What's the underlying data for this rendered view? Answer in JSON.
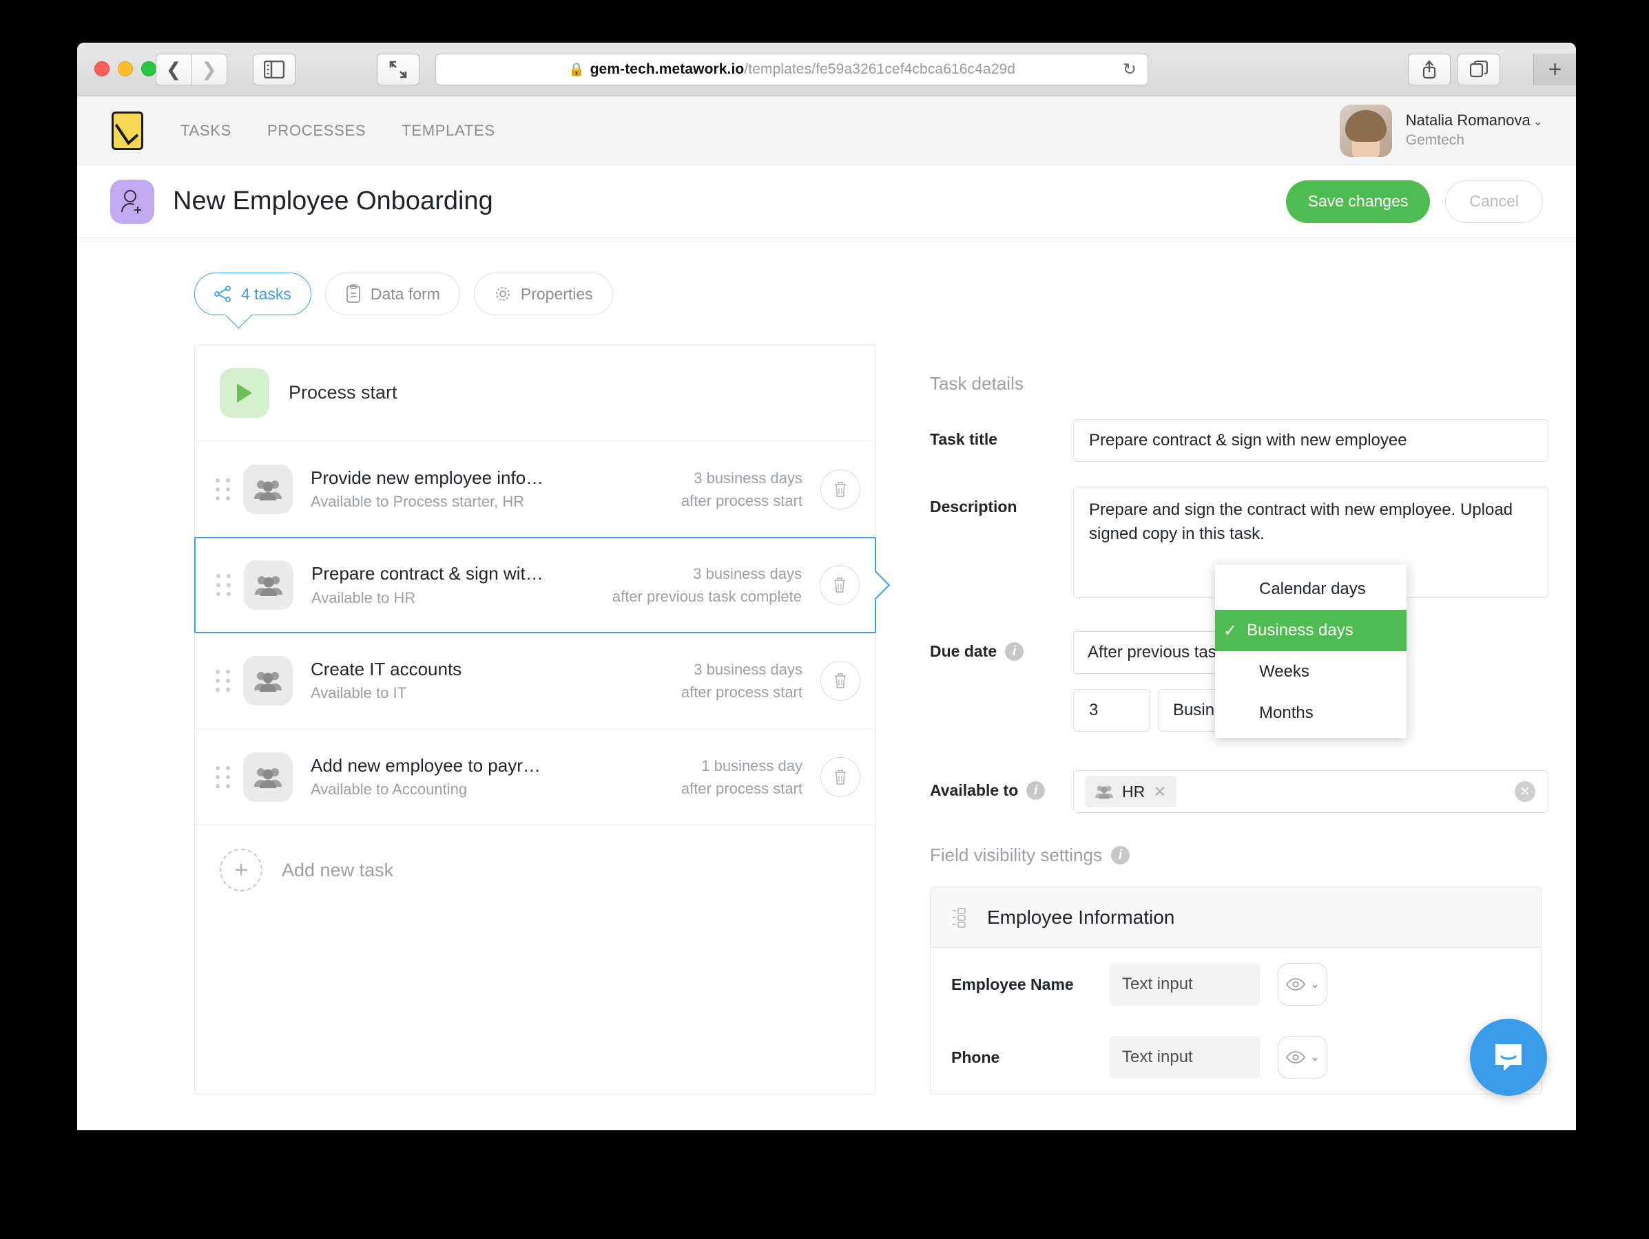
{
  "browser": {
    "url_secure_part": "gem-tech.metawork.io",
    "url_path": "/templates/fe59a3261cef4cbca616c4a29d",
    "back_icon": "back-chevron-icon",
    "forward_icon": "forward-chevron-icon",
    "sidebar_icon": "sidebar-toggle-icon",
    "fullscreen_icon": "fullscreen-icon",
    "reload_icon": "reload-icon",
    "share_icon": "share-icon",
    "tabs_icon": "show-tabs-icon",
    "newtab_label": "+"
  },
  "appnav": {
    "logo_name": "metawork-logo",
    "links": [
      "TASKS",
      "PROCESSES",
      "TEMPLATES"
    ],
    "user": {
      "name": "Natalia Romanova",
      "org": "Gemtech"
    }
  },
  "page_header": {
    "title": "New Employee Onboarding",
    "save_label": "Save changes",
    "cancel_label": "Cancel",
    "accent_green": "#4fbc51"
  },
  "tabs": [
    {
      "label": "4 tasks",
      "icon": "workflow-icon",
      "active": true
    },
    {
      "label": "Data form",
      "icon": "clipboard-icon",
      "active": false
    },
    {
      "label": "Properties",
      "icon": "gear-icon",
      "active": false
    }
  ],
  "task_list": {
    "process_start_label": "Process start",
    "add_new_task_label": "Add new task",
    "tasks": [
      {
        "title": "Provide new employee info…",
        "available": "Available to Process starter, HR",
        "due_amount": "3 business days",
        "due_when": "after process start",
        "selected": false
      },
      {
        "title": "Prepare contract & sign wit…",
        "available": "Available to HR",
        "due_amount": "3 business days",
        "due_when": "after previous task complete",
        "selected": true
      },
      {
        "title": "Create IT accounts",
        "available": "Available to IT",
        "due_amount": "3 business days",
        "due_when": "after process start",
        "selected": false
      },
      {
        "title": "Add new employee to payr…",
        "available": "Available to Accounting",
        "due_amount": "1 business day",
        "due_when": "after process start",
        "selected": false
      }
    ]
  },
  "details": {
    "section_title": "Task details",
    "task_title_label": "Task title",
    "task_title_value": "Prepare contract & sign with new employee",
    "description_label": "Description",
    "description_value": "Prepare and sign the contract with new employee. Upload signed copy in this task.",
    "due_date_label": "Due date",
    "due_date_trigger": "After previous task complete",
    "due_amount_value": "3",
    "due_unit_value": "Business days",
    "due_unit_options": [
      "Calendar days",
      "Business days",
      "Weeks",
      "Months"
    ],
    "due_unit_selected": "Business days",
    "available_to_label": "Available to",
    "available_to_chip": "HR",
    "field_visibility_label": "Field visibility settings"
  },
  "form_card": {
    "title": "Employee Information",
    "rows": [
      {
        "label": "Employee Name",
        "input_placeholder": "Text input"
      },
      {
        "label": "Phone",
        "input_placeholder": "Text input"
      }
    ]
  },
  "widgets": {
    "intercom_icon": "intercom-chat-icon"
  }
}
